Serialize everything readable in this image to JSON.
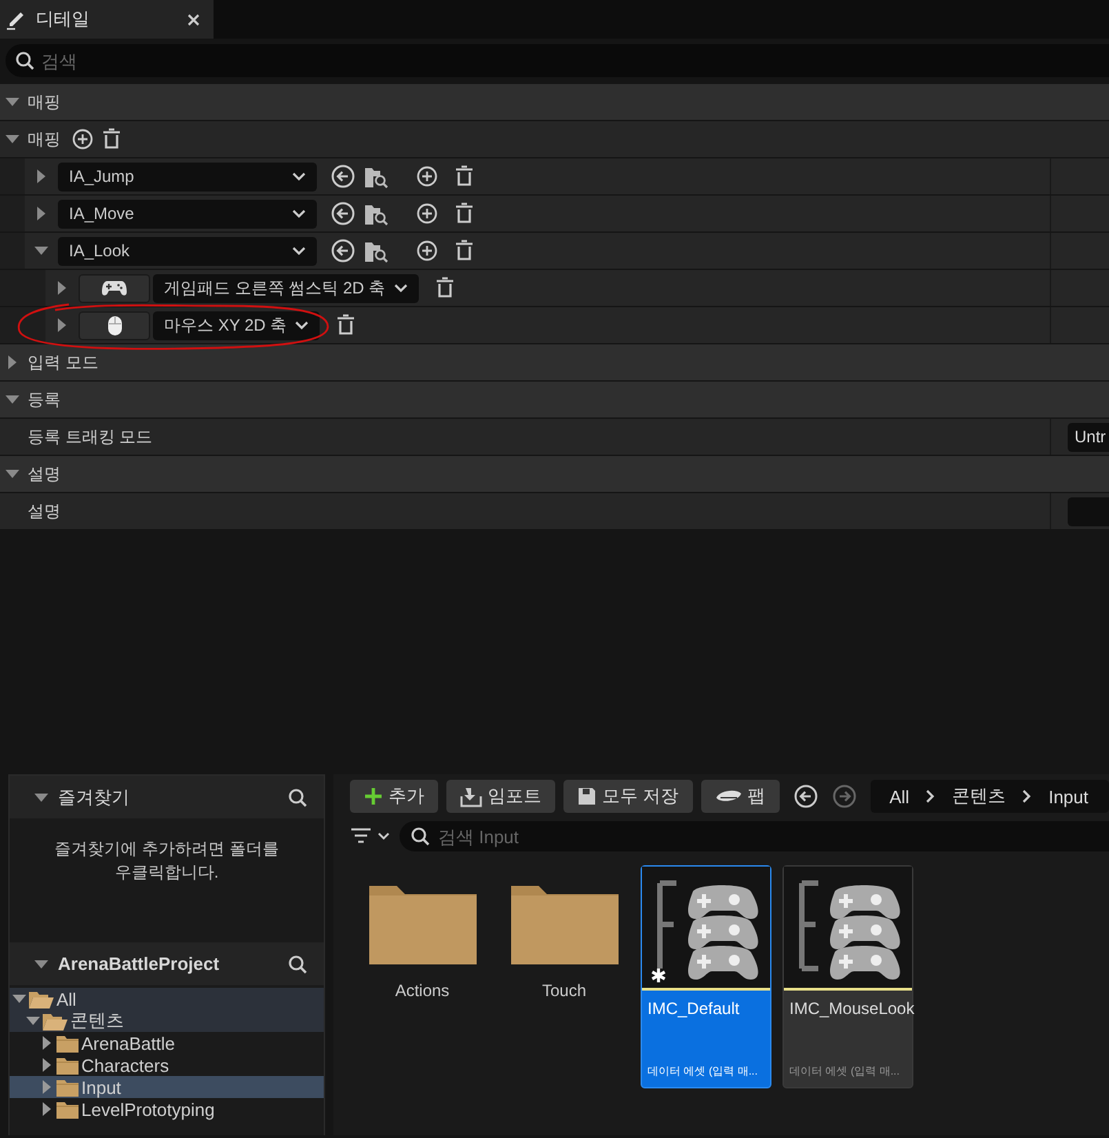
{
  "tab": {
    "title": "디테일"
  },
  "search": {
    "placeholder": "검색"
  },
  "rows": [
    {
      "kind": "category",
      "label": "매핑",
      "expanded": true
    },
    {
      "kind": "array",
      "label": "매핑",
      "expanded": true
    },
    {
      "kind": "mapping",
      "action": "IA_Jump",
      "expanded": false
    },
    {
      "kind": "mapping",
      "action": "IA_Move",
      "expanded": false
    },
    {
      "kind": "mapping",
      "action": "IA_Look",
      "expanded": true
    },
    {
      "kind": "gamepad_key",
      "key": "게임패드 오른쪽 썸스틱 2D 축",
      "expanded": false
    },
    {
      "kind": "mouse_key",
      "key": "마우스 XY 2D 축",
      "expanded": false
    },
    {
      "kind": "category",
      "label": "입력 모드",
      "expanded": false
    },
    {
      "kind": "category",
      "label": "등록",
      "expanded": true
    },
    {
      "kind": "property",
      "label": "등록 트래킹 모드",
      "value": "Untr"
    },
    {
      "kind": "category",
      "label": "설명",
      "expanded": true
    },
    {
      "kind": "property",
      "label": "설명"
    }
  ],
  "content_browser": {
    "favorites": {
      "title": "즐겨찾기",
      "expanded": true,
      "hint": "즐겨찾기에 추가하려면 폴더를 우클릭합니다."
    },
    "project": {
      "title": "ArenaBattleProject",
      "expanded": true
    },
    "tree": [
      {
        "label": "All",
        "expanded": true,
        "selected": false,
        "children": [
          {
            "label": "콘텐츠",
            "expanded": true,
            "selected": false,
            "children": [
              {
                "label": "ArenaBattle",
                "expanded": false,
                "selected": false
              },
              {
                "label": "Characters",
                "expanded": false,
                "selected": false
              },
              {
                "label": "Input",
                "expanded": false,
                "selected": true
              },
              {
                "label": "LevelPrototyping",
                "expanded": false,
                "selected": false
              }
            ]
          }
        ]
      }
    ],
    "toolbar": [
      {
        "kind": "add",
        "label": "추가"
      },
      {
        "kind": "import",
        "label": "임포트"
      },
      {
        "kind": "save",
        "label": "모두 저장"
      },
      {
        "kind": "fab",
        "label": "팹"
      }
    ],
    "history": [
      {
        "kind": "back",
        "disabled": false
      },
      {
        "kind": "forward",
        "disabled": true
      }
    ],
    "breadcrumb": [
      "All",
      "콘텐츠",
      "Input"
    ],
    "search": {
      "placeholder": "검색 Input"
    },
    "items": [
      {
        "kind": "folder",
        "label": "Actions",
        "selected": false
      },
      {
        "kind": "folder",
        "label": "Touch",
        "selected": false
      },
      {
        "kind": "asset",
        "label": "IMC_Default",
        "type": "데이터 에셋 (입력 매...",
        "modified": true,
        "selected": true
      },
      {
        "kind": "asset",
        "label": "IMC_MouseLook",
        "type": "데이터 에셋 (입력 매...",
        "modified": false,
        "selected": false
      }
    ]
  }
}
